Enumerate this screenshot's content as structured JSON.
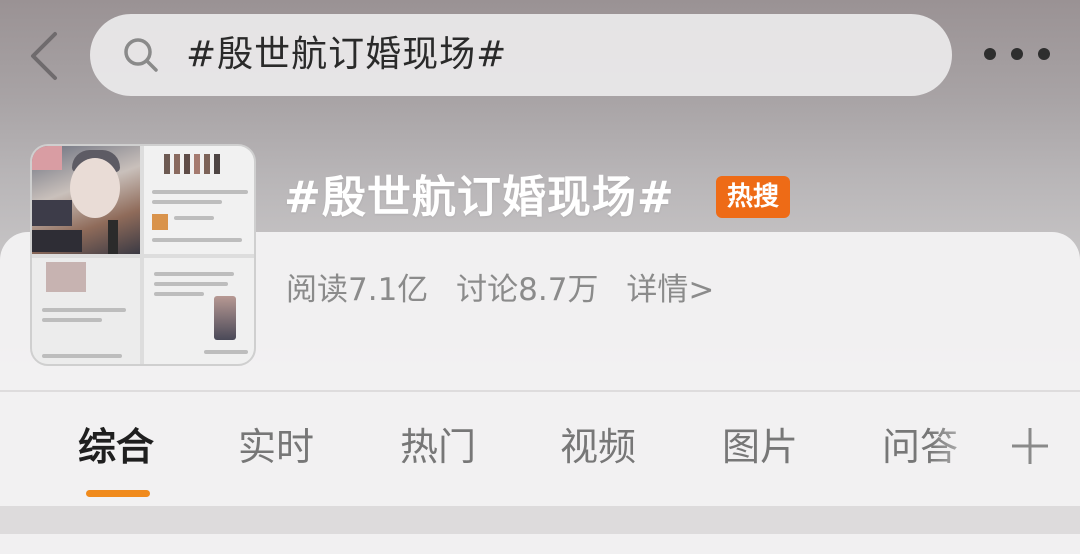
{
  "search": {
    "query": "#殷世航订婚现场#"
  },
  "topic": {
    "title": "#殷世航订婚现场#",
    "badge": "热搜",
    "reads": "阅读7.1亿",
    "discussions": "讨论8.7万",
    "details": "详情>"
  },
  "tabs": [
    {
      "label": "综合",
      "active": true
    },
    {
      "label": "实时"
    },
    {
      "label": "热门"
    },
    {
      "label": "视频"
    },
    {
      "label": "图片"
    },
    {
      "label": "问答"
    }
  ],
  "colors": {
    "accent": "#f08a1c",
    "badge": "#ee6b16"
  },
  "icons": {
    "back": "chevron-left-icon",
    "search": "search-icon",
    "more": "more-dots-icon",
    "add": "plus-icon"
  }
}
